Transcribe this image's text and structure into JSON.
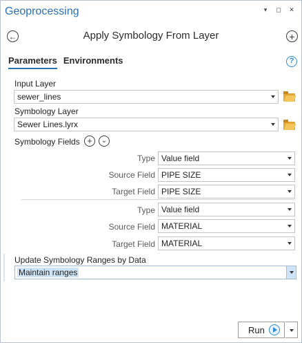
{
  "pane": {
    "title": "Geoprocessing",
    "controls": [
      {
        "icon": "pin-dropdown-icon",
        "glyph": "▾"
      },
      {
        "icon": "maximize-icon",
        "glyph": "◻"
      },
      {
        "icon": "close-icon",
        "glyph": "✕"
      }
    ]
  },
  "tool": {
    "title": "Apply Symbology From Layer",
    "back_glyph": "←",
    "add_glyph": "+"
  },
  "tabs": [
    {
      "label": "Parameters",
      "active": true
    },
    {
      "label": "Environments",
      "active": false
    }
  ],
  "help_glyph": "?",
  "input_layer": {
    "label": "Input Layer",
    "value": "sewer_lines"
  },
  "symbology_layer": {
    "label": "Symbology Layer",
    "value": "Sewer Lines.lyrx"
  },
  "symbology_fields": {
    "label": "Symbology Fields",
    "add_glyph": "+",
    "expand_glyph": "⌄",
    "rows": [
      {
        "type_label": "Type",
        "type_value": "Value field",
        "source_label": "Source Field",
        "source_value": "PIPE SIZE",
        "target_label": "Target Field",
        "target_value": "PIPE SIZE"
      },
      {
        "type_label": "Type",
        "type_value": "Value field",
        "source_label": "Source Field",
        "source_value": "MATERIAL",
        "target_label": "Target Field",
        "target_value": "MATERIAL"
      }
    ]
  },
  "update_ranges": {
    "label": "Update Symbology Ranges by Data",
    "value": "Maintain ranges"
  },
  "run": {
    "label": "Run"
  },
  "colors": {
    "accent": "#2a6fb5",
    "run_icon": "#2f8cd6",
    "folder": "#e0a532",
    "selection": "#cfe3f7"
  }
}
